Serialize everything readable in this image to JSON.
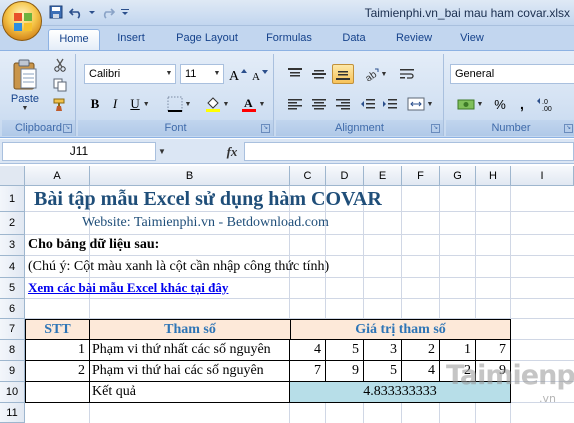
{
  "window": {
    "title": "Taimienphi.vn_bai mau ham covar.xlsx"
  },
  "tabs": [
    {
      "label": "Home",
      "active": true
    },
    {
      "label": "Insert"
    },
    {
      "label": "Page Layout"
    },
    {
      "label": "Formulas"
    },
    {
      "label": "Data"
    },
    {
      "label": "Review"
    },
    {
      "label": "View"
    }
  ],
  "ribbon": {
    "clipboard": {
      "label": "Clipboard",
      "paste": "Paste"
    },
    "font": {
      "label": "Font",
      "name": "Calibri",
      "size": "11"
    },
    "alignment": {
      "label": "Alignment"
    },
    "number": {
      "label": "Number",
      "format": "General"
    }
  },
  "formula_bar": {
    "cell_ref": "J11",
    "fx": "fx",
    "content": ""
  },
  "columns": [
    "A",
    "B",
    "C",
    "D",
    "E",
    "F",
    "G",
    "H",
    "I"
  ],
  "rows": [
    "1",
    "2",
    "3",
    "4",
    "5",
    "6",
    "7",
    "8",
    "9",
    "10",
    "11"
  ],
  "sheet": {
    "title": "Bài tập mẫu Excel sử dụng hàm COVAR",
    "website": "Website: Taimienphi.vn - Betdownload.com",
    "prompt": "Cho bảng dữ liệu sau:",
    "note": "(Chú ý: Cột màu xanh là cột cần nhập công thức tính)",
    "link": "Xem các bài mẫu Excel khác tại đây",
    "table": {
      "headers": {
        "stt": "STT",
        "param": "Tham số",
        "values": "Giá trị tham số"
      },
      "rows": [
        {
          "stt": "1",
          "label": "Phạm vi thứ nhất các số nguyên",
          "values": [
            "4",
            "5",
            "3",
            "2",
            "1",
            "7"
          ]
        },
        {
          "stt": "2",
          "label": "Phạm vi thứ hai các số nguyên",
          "values": [
            "7",
            "9",
            "5",
            "4",
            "2",
            "9"
          ]
        }
      ],
      "result_label": "Kết quả",
      "result_value": "4.833333333"
    }
  },
  "watermark": {
    "text": "Taimienphi",
    "suffix": ".vn"
  },
  "colors": {
    "header_fill": "#fde9d9",
    "result_fill": "#b7dee8",
    "header_text": "#2e75b6",
    "title_text": "#1f4e79"
  }
}
